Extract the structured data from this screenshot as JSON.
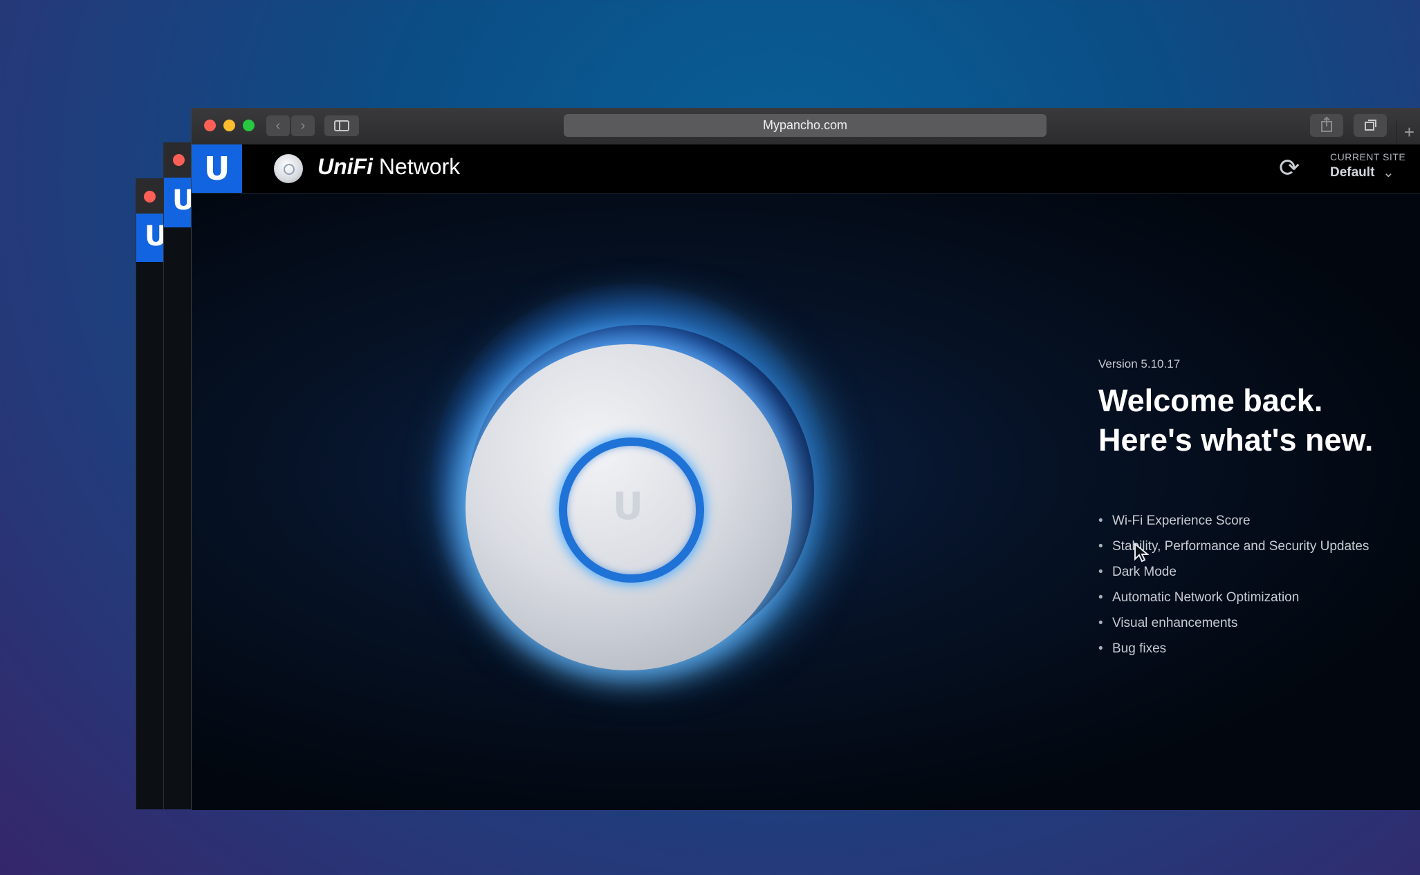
{
  "browser": {
    "url": "Mypancho.com",
    "nav": {
      "back_icon": "chevron-left-icon",
      "forward_icon": "chevron-right-icon"
    },
    "new_tab_label": "+"
  },
  "app": {
    "brand_prefix": "UniFi",
    "brand_suffix": "Network",
    "current_site_label": "CURRENT SITE",
    "current_site_value": "Default"
  },
  "welcome": {
    "version": "Version 5.10.17",
    "headline_line1": "Welcome back.",
    "headline_line2": "Here's what's new.",
    "features": [
      "Wi-Fi Experience Score",
      "Stability, Performance and Security Updates",
      "Dark Mode",
      "Automatic Network Optimization",
      "Visual enhancements",
      "Bug fixes"
    ]
  },
  "colors": {
    "accent": "#1264e0",
    "ring": "#1f72d6"
  }
}
